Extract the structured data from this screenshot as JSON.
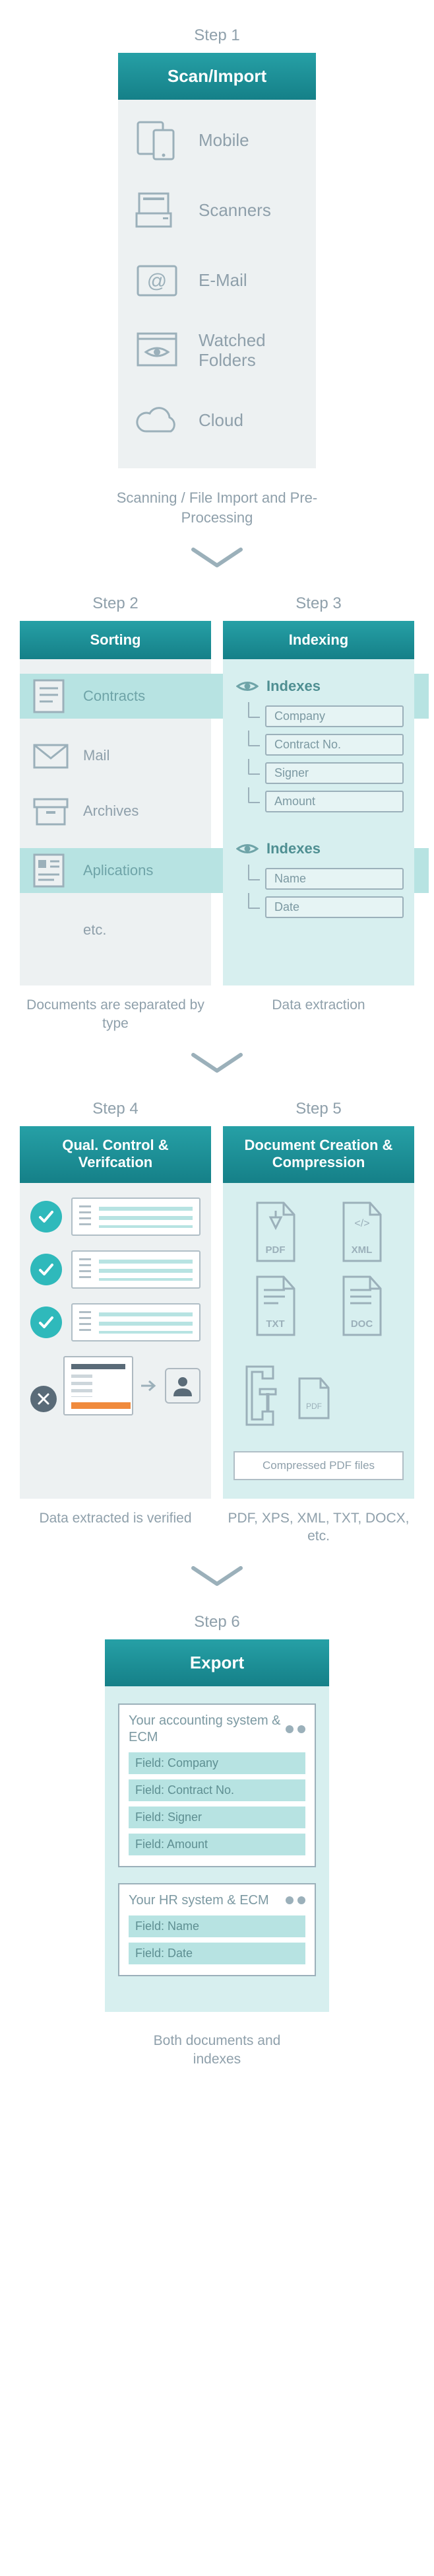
{
  "colors": {
    "teal_dark": "#158088",
    "teal": "#26a0a6",
    "teal_light": "#b7e3e2",
    "teal_pale": "#d7efef",
    "gray_bg": "#edf1f2",
    "gray_line": "#9bb0ba",
    "text_muted": "#8fa0ab",
    "orange": "#f08a3c"
  },
  "step1": {
    "step_label": "Step 1",
    "title": "Scan/Import",
    "items": [
      {
        "icon": "mobile-icon",
        "label": "Mobile"
      },
      {
        "icon": "scanner-icon",
        "label": "Scanners"
      },
      {
        "icon": "email-icon",
        "label": "E-Mail"
      },
      {
        "icon": "watched-folder-icon",
        "label": "Watched Folders"
      },
      {
        "icon": "cloud-icon",
        "label": "Cloud"
      }
    ],
    "caption": "Scanning / File Import and Pre-Processing"
  },
  "step2": {
    "step_label": "Step 2",
    "title": "Sorting",
    "rows": [
      {
        "icon": "doc-contracts-icon",
        "label": "Contracts",
        "linked": true
      },
      {
        "icon": "mail-icon",
        "label": "Mail",
        "linked": false
      },
      {
        "icon": "archive-icon",
        "label": "Archives",
        "linked": false
      },
      {
        "icon": "doc-applications-icon",
        "label": "Aplications",
        "linked": true
      },
      {
        "icon": "",
        "label": "etc.",
        "linked": false
      }
    ],
    "caption": "Documents are separated by type"
  },
  "step3": {
    "step_label": "Step 3",
    "title": "Indexing",
    "groups": [
      {
        "heading": "Indexes",
        "fields": [
          "Company",
          "Contract No.",
          "Signer",
          "Amount"
        ]
      },
      {
        "heading": "Indexes",
        "fields": [
          "Name",
          "Date"
        ]
      }
    ],
    "caption": "Data extraction"
  },
  "step4": {
    "step_label": "Step 4",
    "title": "Qual. Control & Verifcation",
    "caption": "Data extracted is verified"
  },
  "step5": {
    "step_label": "Step 5",
    "title": "Document Creation & Compression",
    "file_types": [
      "PDF",
      "XML",
      "TXT",
      "DOC"
    ],
    "compressed_label": "Compressed PDF files",
    "caption": "PDF, XPS, XML, TXT, DOCX, etc."
  },
  "step6": {
    "step_label": "Step 6",
    "title": "Export",
    "systems": [
      {
        "name": "Your accounting system & ECM",
        "fields": [
          "Field: Company",
          "Field: Contract No.",
          "Field: Signer",
          "Field: Amount"
        ]
      },
      {
        "name": "Your HR system & ECM",
        "fields": [
          "Field: Name",
          "Field: Date"
        ]
      }
    ],
    "caption": "Both documents and indexes"
  }
}
